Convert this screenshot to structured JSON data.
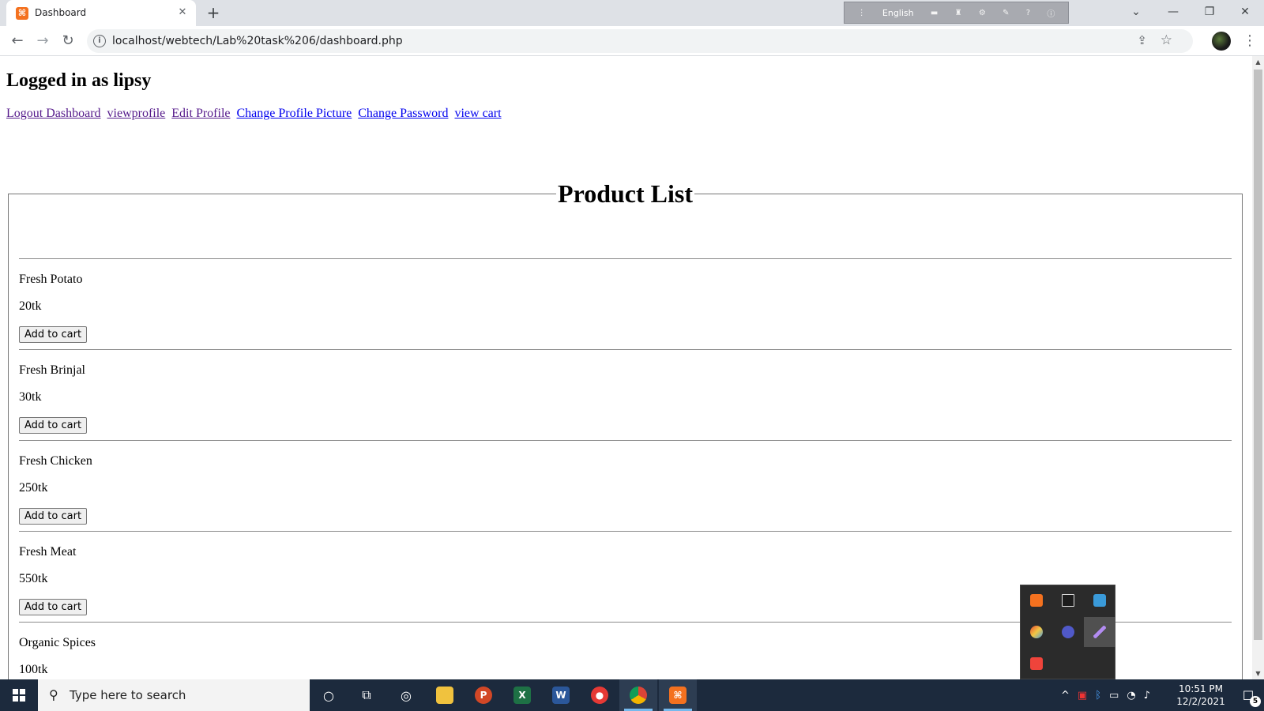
{
  "browser": {
    "tab": {
      "favicon": "xampp-icon",
      "title": "Dashboard",
      "close": "✕"
    },
    "new_tab": "+",
    "ime": {
      "language": "English"
    },
    "window_controls": {
      "tablist": "⌄",
      "minimize": "—",
      "restore": "❐",
      "close": "✕"
    },
    "toolbar": {
      "back": "←",
      "forward": "→",
      "reload": "↻",
      "info": "i",
      "url": "localhost/webtech/Lab%20task%206/dashboard.php",
      "share": "⇪",
      "bookmark": "☆",
      "menu": "⋮"
    }
  },
  "page": {
    "heading": "Logged in as lipsy",
    "nav_links": [
      {
        "label": "Logout Dashboard",
        "visited": true
      },
      {
        "label": "viewprofile",
        "visited": true
      },
      {
        "label": "Edit Profile",
        "visited": true
      },
      {
        "label": "Change Profile Picture",
        "visited": false
      },
      {
        "label": "Change Password",
        "visited": false
      },
      {
        "label": "view cart",
        "visited": false
      }
    ],
    "product_list": {
      "legend": "Product List",
      "button_label": "Add to cart",
      "products": [
        {
          "name": "Fresh Potato",
          "price": "20tk"
        },
        {
          "name": "Fresh Brinjal",
          "price": "30tk"
        },
        {
          "name": "Fresh Chicken",
          "price": "250tk"
        },
        {
          "name": "Fresh Meat",
          "price": "550tk"
        },
        {
          "name": "Organic Spices",
          "price": "100tk"
        }
      ]
    }
  },
  "tray_popup": {
    "icons": [
      "xampp-icon",
      "monitor-icon",
      "network-icon",
      "paint-icon",
      "teams-icon",
      "pen-icon",
      "anydesk-icon"
    ]
  },
  "taskbar": {
    "search_placeholder": "Type here to search",
    "apps": [
      "cortana-icon",
      "task-view-icon",
      "media-icon",
      "file-explorer-icon",
      "powerpoint-icon",
      "excel-icon",
      "word-icon",
      "recorder-icon",
      "chrome-icon",
      "xampp-icon"
    ],
    "clock": {
      "time": "10:51 PM",
      "date": "12/2/2021"
    },
    "notification_count": "5"
  },
  "colors": {
    "link_visited": "#551a8b",
    "link_unvisited": "#0000ee",
    "taskbar_bg": "#1c2a3d",
    "xampp_orange": "#f4711f"
  }
}
